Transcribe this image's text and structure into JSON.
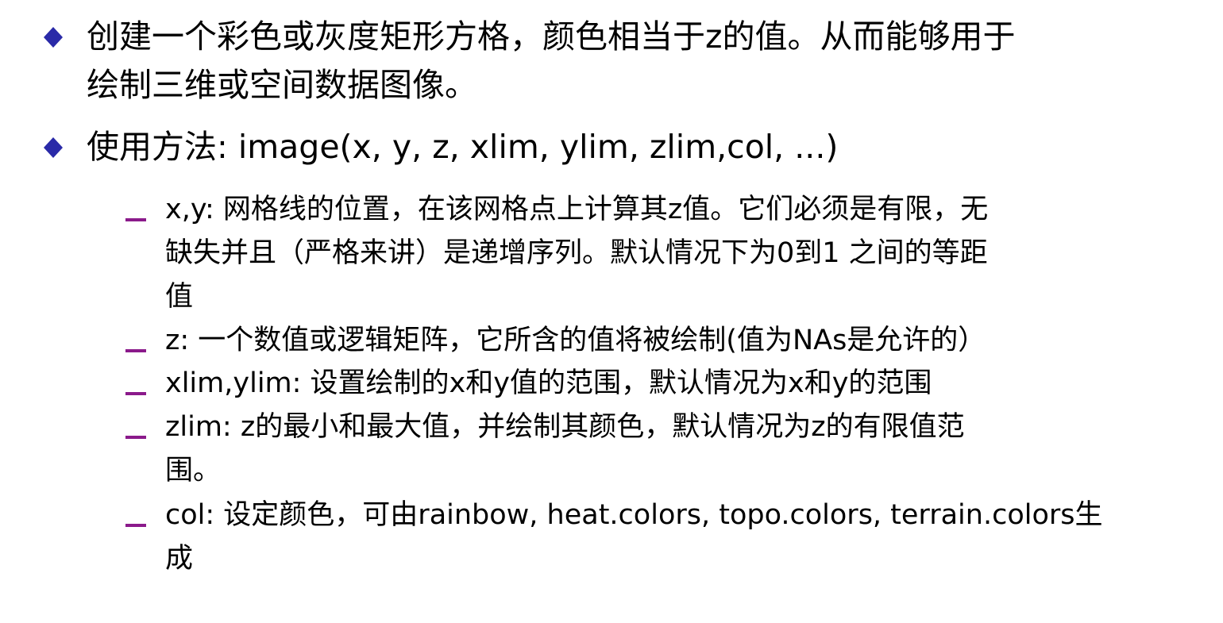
{
  "colors": {
    "bullet_diamond": "#2a2aa8",
    "sub_dash": "#8b1a8b",
    "text": "#000000"
  },
  "bullets": [
    {
      "icon": "diamond-icon",
      "lines": [
        "创建一个彩色或灰度矩形方格，颜色相当于z的值。从而能够用于",
        "绘制三维或空间数据图像。"
      ]
    },
    {
      "icon": "diamond-icon",
      "lines": [
        "使用方法: image(x, y, z, xlim, ylim, zlim,col, ...)"
      ]
    }
  ],
  "sub_bullets": [
    {
      "icon": "dash-icon",
      "lines": [
        "x,y: 网格线的位置，在该网格点上计算其z值。它们必须是有限，无",
        "缺失并且（严格来讲）是递增序列。默认情况下为0到1 之间的等距",
        "值"
      ]
    },
    {
      "icon": "dash-icon",
      "lines": [
        "z: 一个数值或逻辑矩阵，它所含的值将被绘制(值为NAs是允许的）"
      ]
    },
    {
      "icon": "dash-icon",
      "lines": [
        "xlim,ylim: 设置绘制的x和y值的范围，默认情况为x和y的范围"
      ]
    },
    {
      "icon": "dash-icon",
      "lines": [
        "zlim: z的最小和最大值，并绘制其颜色，默认情况为z的有限值范",
        "围。"
      ]
    },
    {
      "icon": "dash-icon",
      "lines": [
        "col: 设定颜色，可由rainbow, heat.colors, topo.colors, terrain.colors生",
        "成"
      ]
    }
  ]
}
